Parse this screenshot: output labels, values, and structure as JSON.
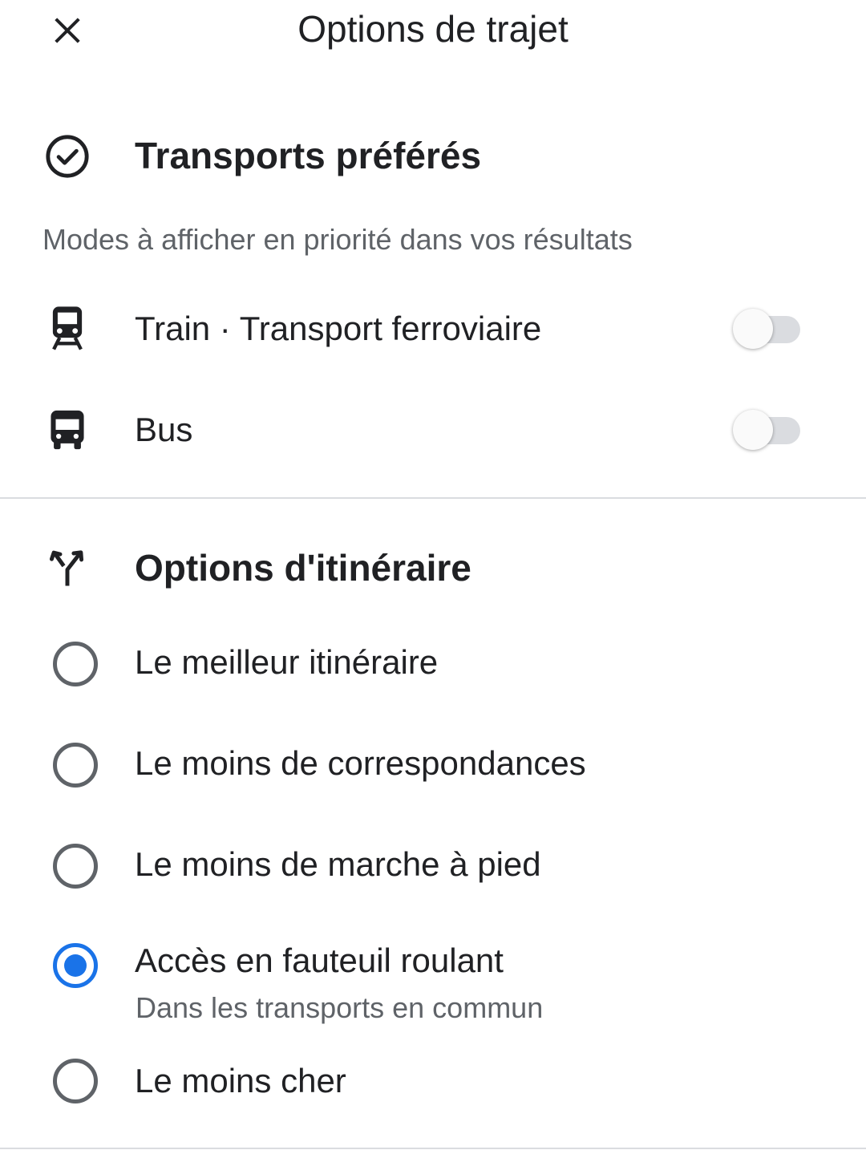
{
  "header": {
    "title": "Options de trajet",
    "close_icon": "close-icon"
  },
  "preferred_transport": {
    "icon": "check-circle-icon",
    "title": "Transports préférés",
    "subtitle": "Modes à afficher en priorité dans vos résultats",
    "items": [
      {
        "icon": "train-icon",
        "label": "Train · Transport ferroviaire",
        "enabled": false
      },
      {
        "icon": "bus-icon",
        "label": "Bus",
        "enabled": false
      }
    ]
  },
  "route_options": {
    "icon": "route-fork-icon",
    "title": "Options d'itinéraire",
    "options": [
      {
        "label": "Le meilleur itinéraire",
        "selected": false
      },
      {
        "label": "Le moins de correspondances",
        "selected": false
      },
      {
        "label": "Le moins de marche à pied",
        "selected": false
      },
      {
        "label": "Accès en fauteuil roulant",
        "sublabel": "Dans les transports en commun",
        "selected": true
      },
      {
        "label": "Le moins cher",
        "selected": false
      }
    ]
  },
  "colors": {
    "accent": "#1a73e8",
    "text_primary": "#202124",
    "text_secondary": "#5f6368",
    "divider": "#dadce0"
  }
}
